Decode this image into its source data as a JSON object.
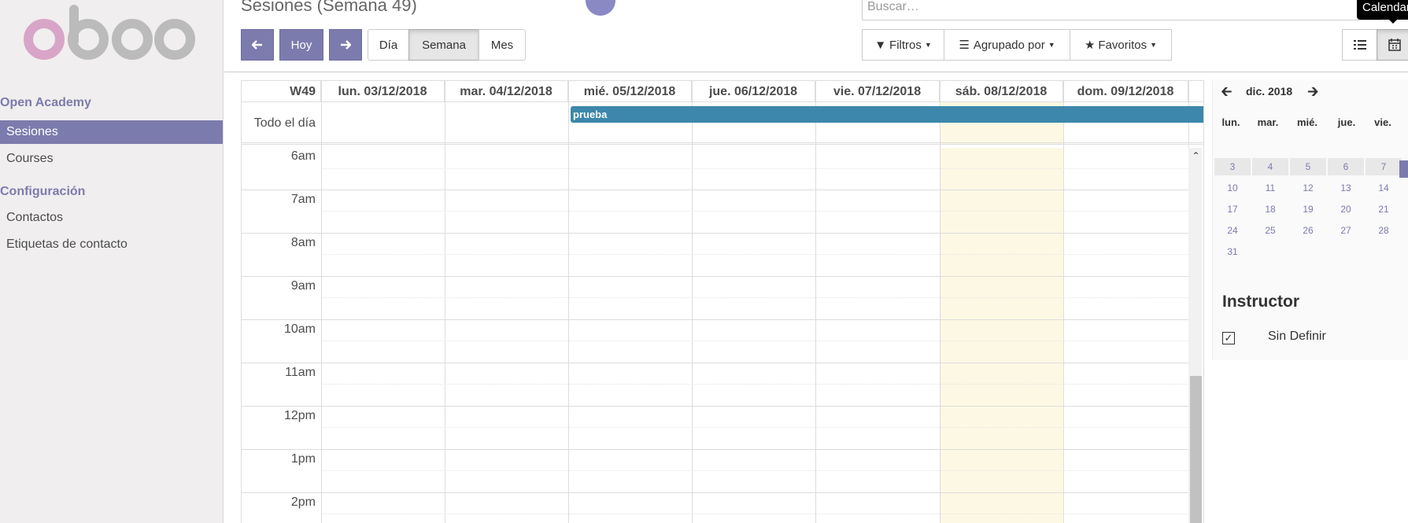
{
  "sidebar": {
    "logo_text": "odoo",
    "sections": [
      {
        "title": "Open Academy",
        "items": [
          {
            "label": "Sesiones",
            "active": true
          },
          {
            "label": "Courses",
            "active": false
          }
        ]
      },
      {
        "title": "Configuración",
        "items": [
          {
            "label": "Contactos",
            "active": false
          },
          {
            "label": "Etiquetas de contacto",
            "active": false
          }
        ]
      }
    ]
  },
  "header": {
    "title": "Sesiones (Semana 49)",
    "search_placeholder": "Buscar…",
    "tooltip": "Calendar"
  },
  "toolbar": {
    "prev_icon": "arrow-left-icon",
    "today_label": "Hoy",
    "next_icon": "arrow-right-icon",
    "scales": [
      {
        "label": "Día",
        "active": false
      },
      {
        "label": "Semana",
        "active": true
      },
      {
        "label": "Mes",
        "active": false
      }
    ],
    "filters_label": "Filtros",
    "groupby_label": "Agrupado por",
    "favorites_label": "Favoritos",
    "views": [
      {
        "icon": "list-icon",
        "active": false
      },
      {
        "icon": "calendar-icon",
        "active": true
      }
    ]
  },
  "calendar": {
    "week_label": "W49",
    "days": [
      "lun. 03/12/2018",
      "mar. 04/12/2018",
      "mié. 05/12/2018",
      "jue. 06/12/2018",
      "vie. 07/12/2018",
      "sáb. 08/12/2018",
      "dom. 09/12/2018"
    ],
    "allday_label": "Todo el día",
    "event": {
      "title": "prueba",
      "color": "#3c87ab"
    },
    "today_highlight_color": "#fcf8e3",
    "hours": [
      "6am",
      "7am",
      "8am",
      "9am",
      "10am",
      "11am",
      "12pm",
      "1pm",
      "2pm"
    ]
  },
  "mini_calendar": {
    "title": "dic. 2018",
    "weekdays": [
      "lun.",
      "mar.",
      "mié.",
      "jue.",
      "vie."
    ],
    "weeks": [
      [
        "3",
        "4",
        "5",
        "6",
        "7"
      ],
      [
        "10",
        "11",
        "12",
        "13",
        "14"
      ],
      [
        "17",
        "18",
        "19",
        "20",
        "21"
      ],
      [
        "24",
        "25",
        "26",
        "27",
        "28"
      ],
      [
        "31"
      ]
    ]
  },
  "filter_panel": {
    "title": "Instructor",
    "items": [
      {
        "label": "Sin Definir",
        "checked": true
      }
    ]
  },
  "colors": {
    "brand": "#7c7bad",
    "event": "#3c87ab"
  }
}
